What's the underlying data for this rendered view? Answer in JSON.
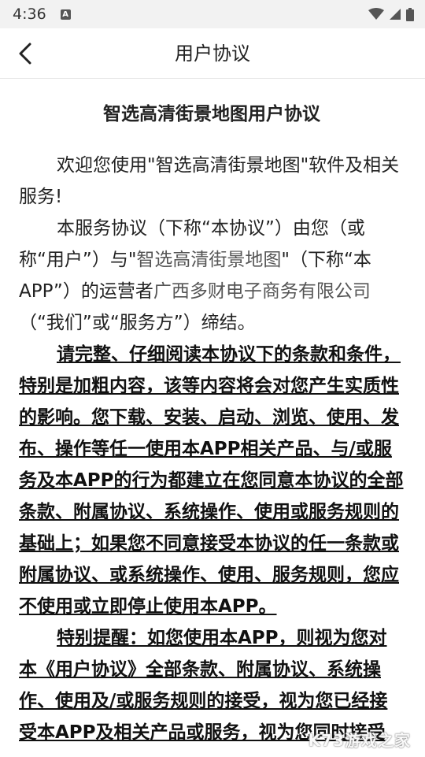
{
  "status_bar": {
    "time": "4:36",
    "notification_icon_letter": "A"
  },
  "nav": {
    "title": "用户协议"
  },
  "doc": {
    "title": "智选高清街景地图用户协议",
    "p1": "欢迎您使用\"智选高清街景地图\"软件及相关服务!",
    "p2_a": "本服务协议（下称“本协议”）由您（或称“用户”）与\"",
    "p2_app": "智选高清街景地图",
    "p2_b": "\"（下称“本APP”）的运营者",
    "p2_company": "广西多财电子商务有限公司",
    "p2_c": "（“我们”或“服务方”）缔结。",
    "p3": "请完整、仔细阅读本协议下的条款和条件，特别是加粗内容，该等内容将会对您产生实质性的影响。您下载、安装、启动、浏览、使用、发布、操作等任一使用本APP相关产品、与/或服务及本APP的行为都建立在您同意本协议的全部条款、附属协议、系统操作、使用或服务规则的基础上；如果您不同意接受本协议的任一条款或附属协议、或系统操作、使用、服务规则，您应不使用或立即停止使用本APP。",
    "p4": "特别提醒：如您使用本APP，则视为您对本《用户协议》全部条款、附属协议、系统操作、使用及/或服务规则的接受，视为您已经接受本APP及相关产品或服务，视为您同时接受"
  },
  "watermark": "K73游戏之家"
}
